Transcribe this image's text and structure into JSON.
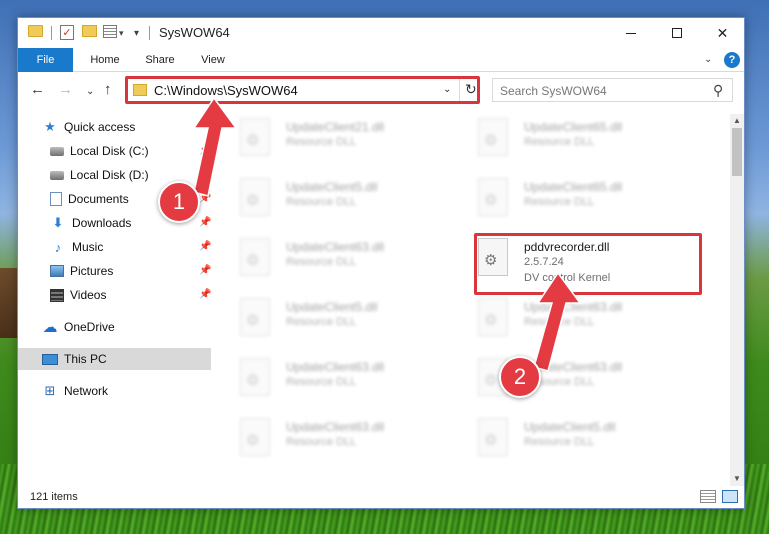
{
  "window": {
    "title": "SysWOW64",
    "min_label": "",
    "max_label": "",
    "close_label": "✕"
  },
  "quick_access_toolbar": {
    "dropdown_glyph": "▾",
    "pin_glyph": "▾"
  },
  "ribbon": {
    "tabs": [
      "File",
      "Home",
      "Share",
      "View"
    ],
    "expand_glyph": "⌄",
    "help_glyph": "?"
  },
  "navigation": {
    "back": "←",
    "forward": "→",
    "recent": "⌄",
    "up": "↑",
    "address": "C:\\Windows\\SysWOW64",
    "address_dropdown": "⌄",
    "refresh": "↻",
    "search_placeholder": "Search SysWOW64",
    "search_icon": "⚲"
  },
  "sidebar": {
    "items": [
      {
        "label": "Quick access",
        "icon": "star-icon",
        "glyph": "★",
        "pinned": false,
        "selected": false
      },
      {
        "label": "Local Disk (C:)",
        "icon": "drive-icon",
        "glyph": "",
        "pinned": true,
        "selected": false
      },
      {
        "label": "Local Disk (D:)",
        "icon": "drive-icon",
        "glyph": "",
        "pinned": true,
        "selected": false
      },
      {
        "label": "Documents",
        "icon": "documents-icon",
        "glyph": "",
        "pinned": true,
        "selected": false
      },
      {
        "label": "Downloads",
        "icon": "download-icon",
        "glyph": "⬇",
        "pinned": true,
        "selected": false
      },
      {
        "label": "Music",
        "icon": "music-icon",
        "glyph": "♪",
        "pinned": true,
        "selected": false
      },
      {
        "label": "Pictures",
        "icon": "pictures-icon",
        "glyph": "",
        "pinned": true,
        "selected": false
      },
      {
        "label": "Videos",
        "icon": "videos-icon",
        "glyph": "",
        "pinned": true,
        "selected": false
      },
      {
        "label": "OneDrive",
        "icon": "cloud-icon",
        "glyph": "☁",
        "pinned": false,
        "selected": false
      },
      {
        "label": "This PC",
        "icon": "computer-icon",
        "glyph": "",
        "pinned": false,
        "selected": true
      },
      {
        "label": "Network",
        "icon": "network-icon",
        "glyph": "⊞",
        "pinned": false,
        "selected": false
      }
    ],
    "pin_glyph": "📌"
  },
  "files": [
    {
      "name": "UpdateClient21.dll",
      "type": "Resource DLL",
      "blurred": true
    },
    {
      "name": "UpdateClient65.dll",
      "type": "Resource DLL",
      "blurred": true
    },
    {
      "name": "UpdateClient5.dll",
      "type": "Resource DLL",
      "blurred": true
    },
    {
      "name": "UpdateClient65.dll",
      "type": "Resource DLL",
      "blurred": true
    },
    {
      "name": "UpdateClient63.dll",
      "type": "Resource DLL",
      "blurred": true
    },
    {
      "name": "pddvrecorder.dll",
      "version": "2.5.7.24",
      "type": "DV control Kernel",
      "blurred": false
    },
    {
      "name": "UpdateClient5.dll",
      "type": "Resource DLL",
      "blurred": true
    },
    {
      "name": "UpdateClient63.dll",
      "type": "Resource DLL",
      "blurred": true
    },
    {
      "name": "UpdateClient63.dll",
      "type": "Resource DLL",
      "blurred": true
    },
    {
      "name": "UpdateClient63.dll",
      "type": "Resource DLL",
      "blurred": true
    },
    {
      "name": "UpdateClient63.dll",
      "type": "Resource DLL",
      "blurred": true
    },
    {
      "name": "UpdateClient5.dll",
      "type": "Resource DLL",
      "blurred": true
    }
  ],
  "statusbar": {
    "item_count": "121 items"
  },
  "annotations": {
    "step1": "1",
    "step2": "2",
    "accent_color": "#e43a42"
  },
  "colors": {
    "file_tab": "#1979ca",
    "selected_nav": "#d9d9d9",
    "highlight": "#d9353d"
  }
}
